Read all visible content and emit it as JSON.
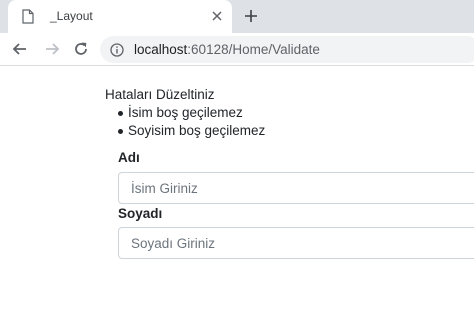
{
  "browser": {
    "tab": {
      "title": "_Layout"
    },
    "address": {
      "host": "localhost",
      "path": ":60128/Home/Validate"
    }
  },
  "icons": {
    "favicon": "document-icon",
    "tab_close": "close-icon",
    "new_tab": "plus-icon",
    "back": "arrow-left-icon",
    "forward": "arrow-right-icon",
    "reload": "reload-icon",
    "site_info": "info-icon"
  },
  "validation": {
    "title": "Hataları Düzeltiniz",
    "errors": [
      "İsim boş geçilemez",
      "Soyisim boş geçilemez"
    ]
  },
  "form": {
    "name": {
      "label": "Adı",
      "placeholder": "İsim Giriniz",
      "value": ""
    },
    "surname": {
      "label": "Soyadı",
      "placeholder": "Soyadı Giriniz",
      "value": ""
    }
  }
}
